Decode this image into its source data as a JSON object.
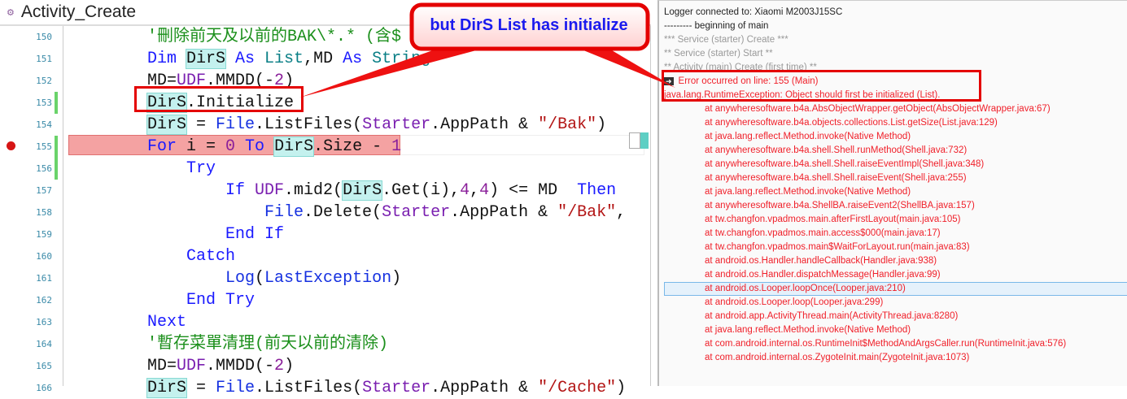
{
  "editor": {
    "tab_title": "Activity_Create",
    "line_numbers": [
      "150",
      "151",
      "152",
      "153",
      "154",
      "155",
      "156",
      "157",
      "158",
      "159",
      "160",
      "161",
      "162",
      "163",
      "164",
      "165",
      "166"
    ],
    "lines": [
      [
        [
          "'刪除前天及以前的BAK\\*.* (含$",
          "cm"
        ]
      ],
      [
        [
          "Dim ",
          "kw"
        ],
        [
          "DirS",
          "hv"
        ],
        [
          " As ",
          "kw"
        ],
        [
          "List",
          "ty"
        ],
        [
          ",MD ",
          ""
        ],
        [
          "As ",
          "kw"
        ],
        [
          "String",
          "ty"
        ]
      ],
      [
        [
          "MD=",
          ""
        ],
        [
          "UDF",
          "md"
        ],
        [
          ".MMDD(-",
          ""
        ],
        [
          "2",
          "num"
        ],
        [
          ")",
          ""
        ]
      ],
      [
        [
          "DirS",
          "hv"
        ],
        [
          ".Initialize",
          ""
        ]
      ],
      [
        [
          "DirS",
          "hv"
        ],
        [
          " = ",
          ""
        ],
        [
          "File",
          "ob"
        ],
        [
          ".ListFiles(",
          ""
        ],
        [
          "Starter",
          "md"
        ],
        [
          ".AppPath & ",
          ""
        ],
        [
          "\"/Bak\"",
          "str"
        ],
        [
          ")",
          ""
        ]
      ],
      [
        [
          "For ",
          "kw"
        ],
        [
          "i = ",
          ""
        ],
        [
          "0",
          "num"
        ],
        [
          " To ",
          "kw"
        ],
        [
          "DirS",
          "hv"
        ],
        [
          ".Size - ",
          ""
        ],
        [
          "1",
          "num"
        ]
      ],
      [
        [
          "    ",
          ""
        ],
        [
          "Try",
          "kw"
        ]
      ],
      [
        [
          "        ",
          ""
        ],
        [
          "If ",
          "kw"
        ],
        [
          "UDF",
          "md"
        ],
        [
          ".mid2(",
          ""
        ],
        [
          "DirS",
          "hv"
        ],
        [
          ".Get(i),",
          ""
        ],
        [
          "4",
          "num"
        ],
        [
          ",",
          ""
        ],
        [
          "4",
          "num"
        ],
        [
          ") <= MD  ",
          ""
        ],
        [
          "Then",
          "kw"
        ]
      ],
      [
        [
          "            ",
          ""
        ],
        [
          "File",
          "ob"
        ],
        [
          ".Delete(",
          ""
        ],
        [
          "Starter",
          "md"
        ],
        [
          ".AppPath & ",
          ""
        ],
        [
          "\"/Bak\"",
          "str"
        ],
        [
          ",",
          ""
        ]
      ],
      [
        [
          "        ",
          ""
        ],
        [
          "End If",
          "kw"
        ]
      ],
      [
        [
          "    ",
          ""
        ],
        [
          "Catch",
          "kw"
        ]
      ],
      [
        [
          "        ",
          ""
        ],
        [
          "Log",
          "ob"
        ],
        [
          "(",
          ""
        ],
        [
          "LastException",
          "ob"
        ],
        [
          ")",
          ""
        ]
      ],
      [
        [
          "    ",
          ""
        ],
        [
          "End Try",
          "kw"
        ]
      ],
      [
        [
          "Next",
          "kw"
        ]
      ],
      [
        [
          "'暫存菜單清理(前天以前的清除)",
          "cm"
        ]
      ],
      [
        [
          "MD=",
          ""
        ],
        [
          "UDF",
          "md"
        ],
        [
          ".MMDD(-",
          ""
        ],
        [
          "2",
          "num"
        ],
        [
          ")",
          ""
        ]
      ],
      [
        [
          "DirS",
          "hv"
        ],
        [
          " = ",
          ""
        ],
        [
          "File",
          "ob"
        ],
        [
          ".ListFiles(",
          ""
        ],
        [
          "Starter",
          "md"
        ],
        [
          ".AppPath & ",
          ""
        ],
        [
          "\"/Cache\"",
          "str"
        ],
        [
          ")",
          ""
        ]
      ]
    ]
  },
  "callout": {
    "text": "but DirS List has initialize"
  },
  "logger": {
    "lines": [
      {
        "t": "Logger connected to:  Xiaomi M2003J15SC",
        "c": "k"
      },
      {
        "t": "--------- beginning of main",
        "c": "k"
      },
      {
        "t": "*** Service (starter) Create ***",
        "c": "g"
      },
      {
        "t": "** Service (starter) Start **",
        "c": "g"
      },
      {
        "t": "** Activity (main) Create (first time) **",
        "c": "g"
      },
      {
        "t": "Error occurred on line: 155 (Main)",
        "c": "r",
        "icon": "arrow-right-icon"
      },
      {
        "t": "java.lang.RuntimeException: Object should first be initialized (List).",
        "c": "r"
      },
      {
        "t": "at anywheresoftware.b4a.AbsObjectWrapper.getObject(AbsObjectWrapper.java:67)",
        "c": "r st"
      },
      {
        "t": "at anywheresoftware.b4a.objects.collections.List.getSize(List.java:129)",
        "c": "r st"
      },
      {
        "t": "at java.lang.reflect.Method.invoke(Native Method)",
        "c": "r st"
      },
      {
        "t": "at anywheresoftware.b4a.shell.Shell.runMethod(Shell.java:732)",
        "c": "r st"
      },
      {
        "t": "at anywheresoftware.b4a.shell.Shell.raiseEventImpl(Shell.java:348)",
        "c": "r st"
      },
      {
        "t": "at anywheresoftware.b4a.shell.Shell.raiseEvent(Shell.java:255)",
        "c": "r st"
      },
      {
        "t": "at java.lang.reflect.Method.invoke(Native Method)",
        "c": "r st"
      },
      {
        "t": "at anywheresoftware.b4a.ShellBA.raiseEvent2(ShellBA.java:157)",
        "c": "r st"
      },
      {
        "t": "at tw.changfon.vpadmos.main.afterFirstLayout(main.java:105)",
        "c": "r st"
      },
      {
        "t": "at tw.changfon.vpadmos.main.access$000(main.java:17)",
        "c": "r st"
      },
      {
        "t": "at tw.changfon.vpadmos.main$WaitForLayout.run(main.java:83)",
        "c": "r st"
      },
      {
        "t": "at android.os.Handler.handleCallback(Handler.java:938)",
        "c": "r st"
      },
      {
        "t": "at android.os.Handler.dispatchMessage(Handler.java:99)",
        "c": "r st"
      },
      {
        "t": "at android.os.Looper.loopOnce(Looper.java:210)",
        "c": "r st"
      },
      {
        "t": "at android.os.Looper.loop(Looper.java:299)",
        "c": "r st"
      },
      {
        "t": "at android.app.ActivityThread.main(ActivityThread.java:8280)",
        "c": "r st"
      },
      {
        "t": "at java.lang.reflect.Method.invoke(Native Method)",
        "c": "r st"
      },
      {
        "t": "at com.android.internal.os.RuntimeInit$MethodAndArgsCaller.run(RuntimeInit.java:576)",
        "c": "r st"
      },
      {
        "t": "at com.android.internal.os.ZygoteInit.main(ZygoteInit.java:1073)",
        "c": "r st"
      }
    ]
  },
  "colors": {
    "error": "#f0202a",
    "keyword": "#1a1aff",
    "callout_border": "#e40000"
  }
}
